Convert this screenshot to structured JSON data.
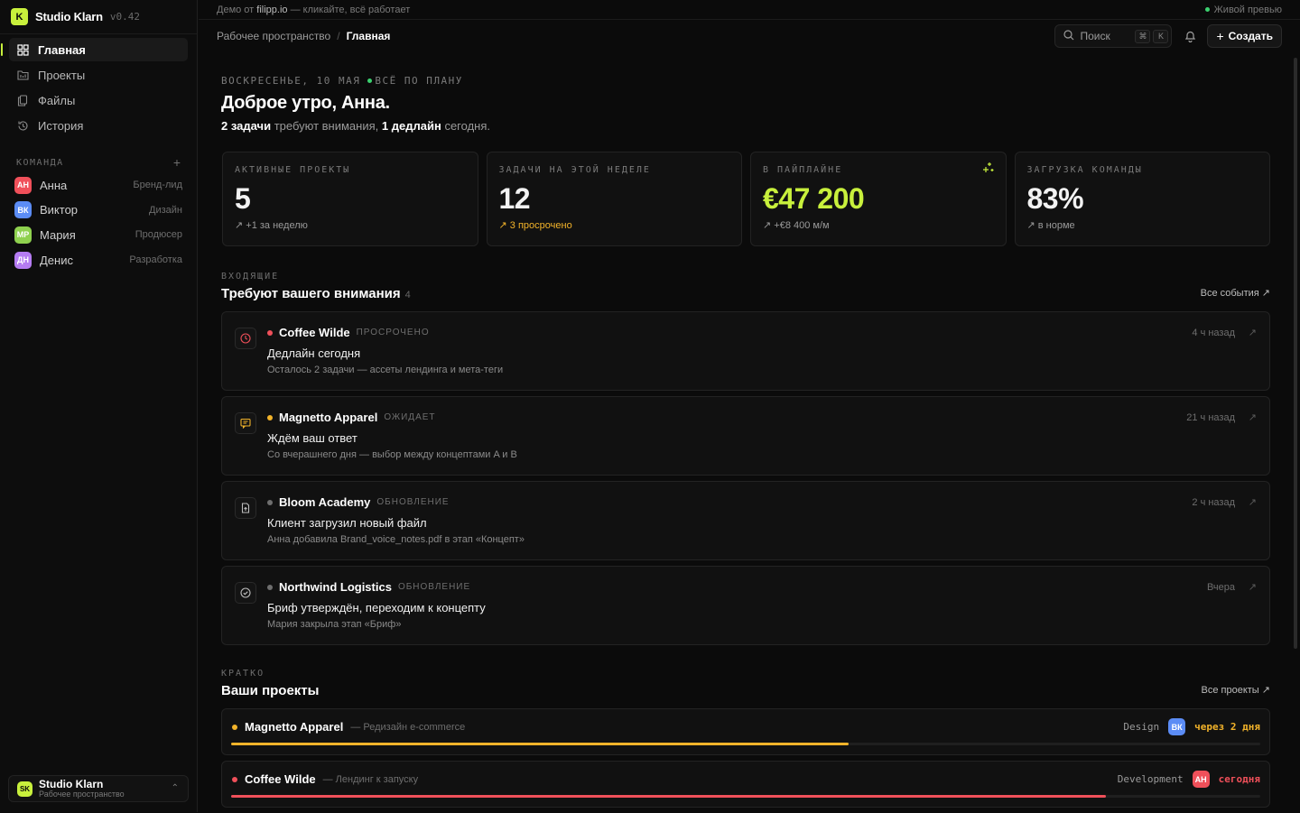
{
  "colors": {
    "accent": "#c8f03c",
    "danger": "#f0505a",
    "warn": "#f2b32a",
    "ok": "#3bd16f",
    "muted": "#6e6e6e"
  },
  "brand": {
    "logo_letter": "K",
    "name": "Studio Klarn",
    "version": "v0.42"
  },
  "nav": [
    {
      "label": "Главная",
      "icon": "grid-icon",
      "active": true
    },
    {
      "label": "Проекты",
      "icon": "folder-icon",
      "active": false
    },
    {
      "label": "Файлы",
      "icon": "files-icon",
      "active": false
    },
    {
      "label": "История",
      "icon": "history-icon",
      "active": false
    }
  ],
  "team": {
    "title": "КОМАНДА",
    "add_icon": "plus-icon",
    "members": [
      {
        "initials": "АН",
        "name": "Анна",
        "role": "Бренд-лид",
        "color": "#f0505a"
      },
      {
        "initials": "ВК",
        "name": "Виктор",
        "role": "Дизайн",
        "color": "#5b8cf5"
      },
      {
        "initials": "МР",
        "name": "Мария",
        "role": "Продюсер",
        "color": "#8fd14f"
      },
      {
        "initials": "ДН",
        "name": "Денис",
        "role": "Разработка",
        "color": "#b57cf2"
      }
    ]
  },
  "workspace": {
    "initials": "SK",
    "name": "Studio Klarn",
    "label": "Рабочее пространство"
  },
  "topbar": {
    "demo_prefix": "Демо от",
    "demo_site": "filipp.io",
    "demo_suffix": "— кликайте, всё работает",
    "live": "Живой превью"
  },
  "breadcrumb": {
    "root": "Рабочее пространство",
    "current": "Главная"
  },
  "search": {
    "label": "Поиск",
    "kbd1": "⌘",
    "kbd2": "K"
  },
  "create_label": "Создать",
  "hero": {
    "date": "ВОСКРЕСЕНЬЕ, 10 МАЯ",
    "status": "ВСЁ ПО ПЛАНУ",
    "greeting": "Доброе утро, Анна.",
    "tasks_bold": "2 задачи",
    "tasks_text": "требуют внимания,",
    "deadline_bold": "1 дедлайн",
    "deadline_text": "сегодня."
  },
  "stats": [
    {
      "label": "АКТИВНЫЕ ПРОЕКТЫ",
      "value": "5",
      "delta": "+1 за неделю"
    },
    {
      "label": "ЗАДАЧИ НА ЭТОЙ НЕДЕЛЕ",
      "value": "12",
      "delta": "3 просрочено"
    },
    {
      "label": "В ПАЙПЛАЙНЕ",
      "value": "€47 200",
      "delta": "+€8 400 м/м"
    },
    {
      "label": "ЗАГРУЗКА КОМАНДЫ",
      "value": "83%",
      "delta": "в норме"
    }
  ],
  "inbox": {
    "kicker": "ВХОДЯЩИЕ",
    "title": "Требуют вашего внимания",
    "count": "4",
    "link": "Все события ↗",
    "items": [
      {
        "icon": "clock-icon",
        "client": "Coffee Wilde",
        "status": "ПРОСРОЧЕНО",
        "dot": "#f0505a",
        "title": "Дедлайн сегодня",
        "desc": "Осталось 2 задачи — ассеты лендинга и мета-теги",
        "time": "4 ч назад"
      },
      {
        "icon": "message-icon",
        "client": "Magnetto Apparel",
        "status": "ОЖИДАЕТ",
        "dot": "#f2b32a",
        "title": "Ждём ваш ответ",
        "desc": "Со вчерашнего дня — выбор между концептами A и B",
        "time": "21 ч назад"
      },
      {
        "icon": "file-upload-icon",
        "client": "Bloom Academy",
        "status": "ОБНОВЛЕНИЕ",
        "dot": "#6e6e6e",
        "title": "Клиент загрузил новый файл",
        "desc": "Анна добавила Brand_voice_notes.pdf в этап «Концепт»",
        "time": "2 ч назад"
      },
      {
        "icon": "check-circle-icon",
        "client": "Northwind Logistics",
        "status": "ОБНОВЛЕНИЕ",
        "dot": "#6e6e6e",
        "title": "Бриф утверждён, переходим к концепту",
        "desc": "Мария закрыла этап «Бриф»",
        "time": "Вчера"
      }
    ]
  },
  "projects": {
    "kicker": "КРАТКО",
    "title": "Ваши проекты",
    "link": "Все проекты ↗",
    "items": [
      {
        "name": "Magnetto Apparel",
        "desc": "— Редизайн e-commerce",
        "stage": "Design",
        "owner": "ВК",
        "owner_color": "#5b8cf5",
        "due": "через 2 дня",
        "color": "#f2b32a",
        "progress": 0.6
      },
      {
        "name": "Coffee Wilde",
        "desc": "— Лендинг к запуску",
        "stage": "Development",
        "owner": "АН",
        "owner_color": "#f0505a",
        "due": "сегодня",
        "color": "#f0505a",
        "progress": 0.85
      }
    ]
  }
}
